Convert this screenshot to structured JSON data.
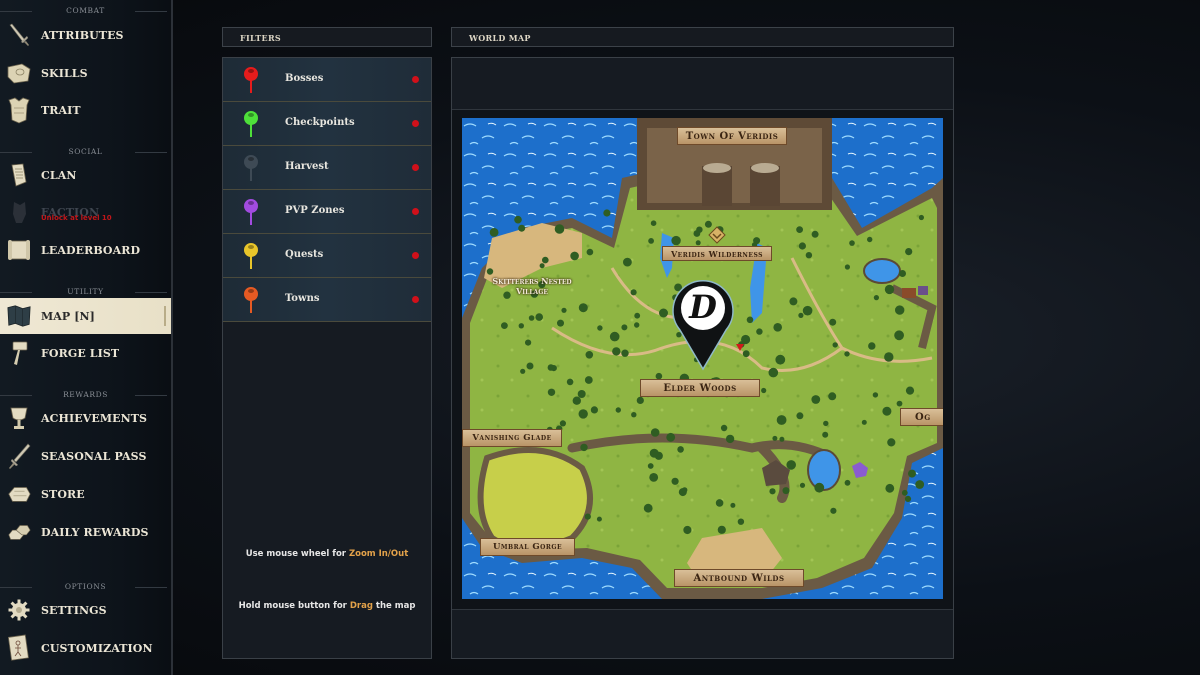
{
  "sidebar": {
    "sections": [
      {
        "title": "COMBAT",
        "items": [
          {
            "label": "ATTRIBUTES",
            "icon": "sword-icon"
          },
          {
            "label": "SKILLS",
            "icon": "book-icon"
          },
          {
            "label": "TRAIT",
            "icon": "armor-icon"
          }
        ]
      },
      {
        "title": "SOCIAL",
        "items": [
          {
            "label": "CLAN",
            "icon": "scroll-icon"
          },
          {
            "label": "FACTION",
            "icon": "helmet-icon",
            "locked": true,
            "lock_text": "Unlock at level 10"
          },
          {
            "label": "LEADERBOARD",
            "icon": "parchment-icon"
          }
        ]
      },
      {
        "title": "UTILITY",
        "items": [
          {
            "label": "MAP [N]",
            "icon": "map-icon",
            "active": true
          },
          {
            "label": "FORGE LIST",
            "icon": "hammer-icon"
          }
        ]
      },
      {
        "title": "REWARDS",
        "items": [
          {
            "label": "ACHIEVEMENTS",
            "icon": "goblet-icon"
          },
          {
            "label": "SEASONAL PASS",
            "icon": "sword-icon"
          },
          {
            "label": "STORE",
            "icon": "gold-icon"
          },
          {
            "label": "DAILY REWARDS",
            "icon": "gold-bars-icon"
          }
        ]
      },
      {
        "title": "OPTIONS",
        "items": [
          {
            "label": "SETTINGS",
            "icon": "gear-icon"
          },
          {
            "label": "CUSTOMIZATION",
            "icon": "character-card-icon"
          }
        ]
      }
    ]
  },
  "filters": {
    "title": "FILTERS",
    "items": [
      {
        "label": "Bosses",
        "pin_color": "#e51c1c",
        "enabled": true
      },
      {
        "label": "Checkpoints",
        "pin_color": "#4ee03a",
        "enabled": true
      },
      {
        "label": "Harvest",
        "pin_color": "#3e4a55",
        "enabled": true
      },
      {
        "label": "PVP Zones",
        "pin_color": "#a24be0",
        "enabled": true
      },
      {
        "label": "Quests",
        "pin_color": "#e8c52a",
        "enabled": true
      },
      {
        "label": "Towns",
        "pin_color": "#e55a23",
        "enabled": true
      }
    ],
    "hints": [
      {
        "prefix": "Use mouse wheel for ",
        "highlight": "Zoom In/Out",
        "suffix": ""
      },
      {
        "prefix": "Hold mouse button for ",
        "highlight": "Drag",
        "suffix": " the map"
      }
    ]
  },
  "world_map": {
    "title": "WORLD MAP",
    "player_marker_letter": "D",
    "locations": [
      {
        "name": "Town Of Veridis"
      },
      {
        "name": "Veridis Wilderness"
      },
      {
        "name": "Skitterers Nested Village"
      },
      {
        "name": "Elder Woods"
      },
      {
        "name": "Vanishing Glade"
      },
      {
        "name": "Umbral Gorge"
      },
      {
        "name": "Antbound Wilds"
      },
      {
        "name": "Og"
      }
    ]
  },
  "colors": {
    "accent_highlight": "#e3a24a",
    "filter_toggle": "#d0101a",
    "lock_text": "#c1161a"
  }
}
